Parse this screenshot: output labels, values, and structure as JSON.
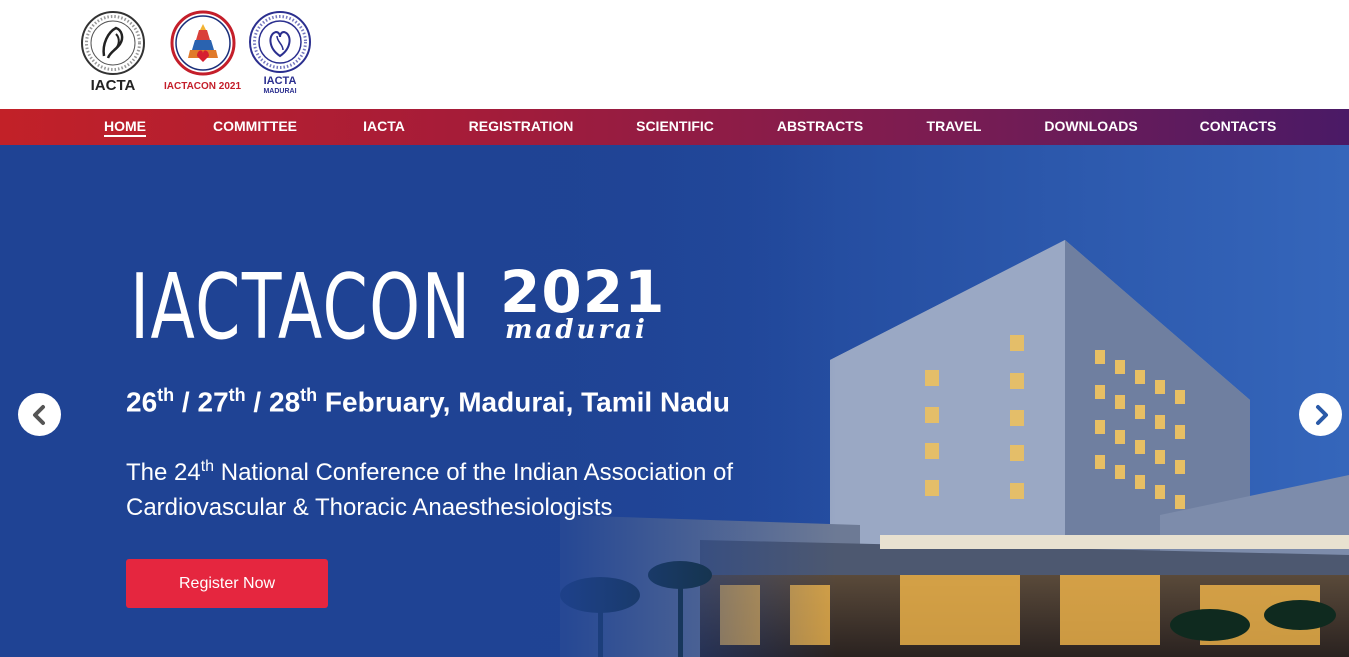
{
  "header": {
    "logos": [
      {
        "caption": "IACTA",
        "icon": "iacta-seal-icon"
      },
      {
        "caption": "IACTACON 2021",
        "icon": "iactacon-temple-icon"
      },
      {
        "caption": "IACTA",
        "subcaption": "MADURAI",
        "icon": "iacta-madurai-heart-icon"
      }
    ]
  },
  "nav": {
    "items": [
      {
        "label": "HOME",
        "active": true
      },
      {
        "label": "COMMITTEE"
      },
      {
        "label": "IACTA"
      },
      {
        "label": "REGISTRATION"
      },
      {
        "label": "SCIENTIFIC"
      },
      {
        "label": "ABSTRACTS"
      },
      {
        "label": "TRAVEL"
      },
      {
        "label": "DOWNLOADS"
      },
      {
        "label": "CONTACTS"
      }
    ]
  },
  "hero": {
    "title": "IACTACON",
    "year": "2021",
    "city": "madurai",
    "dates": {
      "d1": "26",
      "d1_sup": "th",
      "sep1": " / ",
      "d2": "27",
      "d2_sup": "th",
      "sep2": " / ",
      "d3": "28",
      "d3_sup": "th",
      "rest": " February, Madurai, Tamil Nadu"
    },
    "description": {
      "pre": "The 24",
      "sup": "th",
      "post": " National Conference of the Indian Association of Cardiovascular & Thoracic Anaesthesiologists"
    },
    "register_label": "Register Now",
    "prev_icon": "chevron-left-icon",
    "next_icon": "chevron-right-icon"
  },
  "colors": {
    "nav_start": "#c22128",
    "nav_end": "#4a1a66",
    "hero_blue": "#1f4c9f",
    "register_red": "#e5263f"
  }
}
